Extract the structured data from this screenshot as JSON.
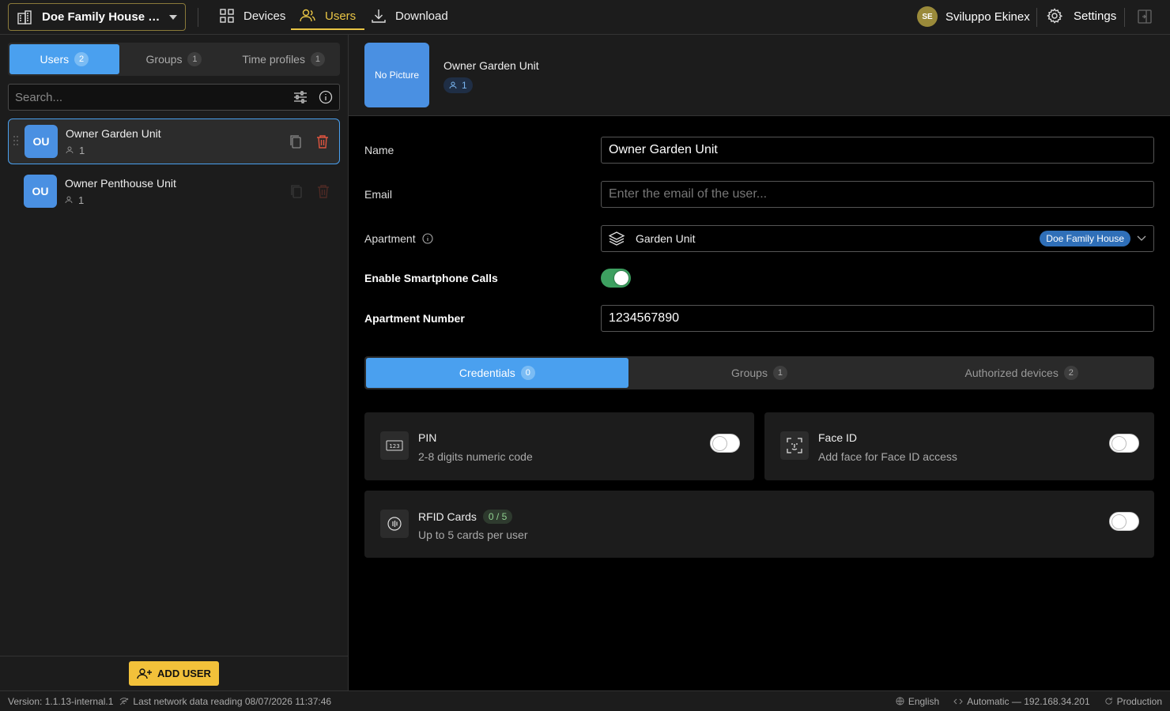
{
  "topbar": {
    "project": "Doe Family House Pro...",
    "nav": [
      {
        "label": "Devices",
        "icon": "grid-icon"
      },
      {
        "label": "Users",
        "icon": "users-icon",
        "active": true
      },
      {
        "label": "Download",
        "icon": "download-icon"
      }
    ],
    "user_initials": "SE",
    "user_name": "Sviluppo Ekinex",
    "settings_label": "Settings"
  },
  "sidebar": {
    "tabs": [
      {
        "label": "Users",
        "count": "2",
        "active": true
      },
      {
        "label": "Groups",
        "count": "1"
      },
      {
        "label": "Time profiles",
        "count": "1"
      }
    ],
    "search_placeholder": "Search...",
    "users": [
      {
        "initials": "OU",
        "name": "Owner Garden Unit",
        "count": "1",
        "selected": true
      },
      {
        "initials": "OU",
        "name": "Owner Penthouse Unit",
        "count": "1"
      }
    ],
    "add_user_label": "ADD USER"
  },
  "detail": {
    "no_picture": "No Picture",
    "name": "Owner Garden Unit",
    "group_count": "1",
    "form": {
      "name_label": "Name",
      "name_value": "Owner Garden Unit",
      "email_label": "Email",
      "email_placeholder": "Enter the email of the user...",
      "apartment_label": "Apartment",
      "apartment_value": "Garden Unit",
      "apartment_pill": "Doe Family House",
      "smartphone_label": "Enable Smartphone Calls",
      "smartphone_enabled": true,
      "apt_number_label": "Apartment Number",
      "apt_number_value": "1234567890"
    },
    "tabs": [
      {
        "label": "Credentials",
        "count": "0",
        "active": true
      },
      {
        "label": "Groups",
        "count": "1"
      },
      {
        "label": "Authorized devices",
        "count": "2"
      }
    ],
    "credentials": {
      "pin": {
        "title": "PIN",
        "subtitle": "2-8 digits numeric code",
        "enabled": false
      },
      "face": {
        "title": "Face ID",
        "subtitle": "Add face for Face ID access",
        "enabled": false
      },
      "rfid": {
        "title": "RFID Cards",
        "badge": "0 / 5",
        "subtitle": "Up to 5 cards per user",
        "enabled": false
      }
    }
  },
  "statusbar": {
    "version": "Version: 1.1.13-internal.1",
    "last_reading": "Last network data reading 08/07/2026 11:37:46",
    "language": "English",
    "network": "Automatic — 192.168.34.201",
    "environment": "Production"
  }
}
